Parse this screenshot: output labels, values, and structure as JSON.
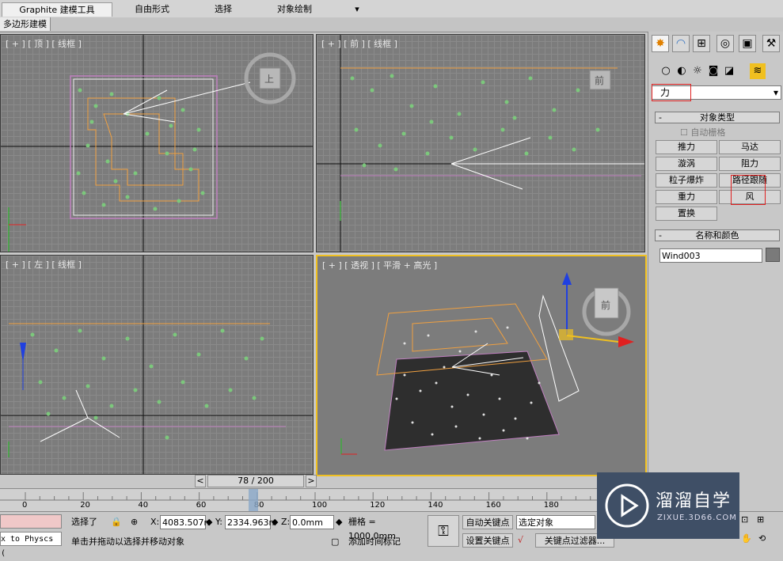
{
  "ribbon": {
    "tabs": [
      "Graphite 建模工具",
      "自由形式",
      "选择",
      "对象绘制"
    ],
    "sub_tab": "多边形建模"
  },
  "viewports": {
    "top_label": "[ + ] [ 顶 ] [ 线框 ]",
    "front_label": "[ + ] [ 前 ] [ 线框 ]",
    "left_label": "[ + ] [ 左 ] [ 线框 ]",
    "persp_label": "[ + ] [ 透视 ] [ 平滑 + 高光 ]",
    "viewcube_top": "上",
    "viewcube_front": "前",
    "viewcube_persp": "前"
  },
  "command_panel": {
    "tab_icons": [
      "create-icon",
      "modify-icon",
      "hierarchy-icon",
      "motion-icon",
      "display-icon",
      "utilities-icon"
    ],
    "category_icons": [
      "geometry-icon",
      "shapes-icon",
      "lights-icon",
      "cameras-icon",
      "helpers-icon",
      "spacewarps-icon"
    ],
    "category_dropdown": "力",
    "object_type_header": "对象类型",
    "autogrid_label": "自动栅格",
    "buttons": [
      "推力",
      "马达",
      "漩涡",
      "阻力",
      "粒子爆炸",
      "路径跟随",
      "重力",
      "风",
      "置换"
    ],
    "name_color_header": "名称和颜色",
    "object_name": "Wind003",
    "object_color": "#7a7a7a"
  },
  "timeline": {
    "frame_display": "78 / 200",
    "current_frame": 78,
    "total_frames": 200,
    "ticks": [
      "0",
      "20",
      "40",
      "60",
      "80",
      "100",
      "120",
      "140",
      "160",
      "180"
    ]
  },
  "status": {
    "script_listener": "x to Physcs (",
    "selected": "选择了",
    "x_value": "4083.507n",
    "y_value": "2334.963n",
    "z_value": "0.0mm",
    "grid": "栅格 = 1000.0mm",
    "autokey": "自动关键点",
    "setkey": "设置关键点",
    "selection_set": "选定对象",
    "prompt": "单击并拖动以选择并移动对象",
    "add_time_tag": "添加时间标记",
    "key_filters": "关键点过滤器...",
    "x_label": "X:",
    "y_label": "Y:",
    "z_label": "Z:"
  },
  "watermark": {
    "brand": "溜溜自学",
    "url": "ZIXUE.3D66.COM"
  }
}
